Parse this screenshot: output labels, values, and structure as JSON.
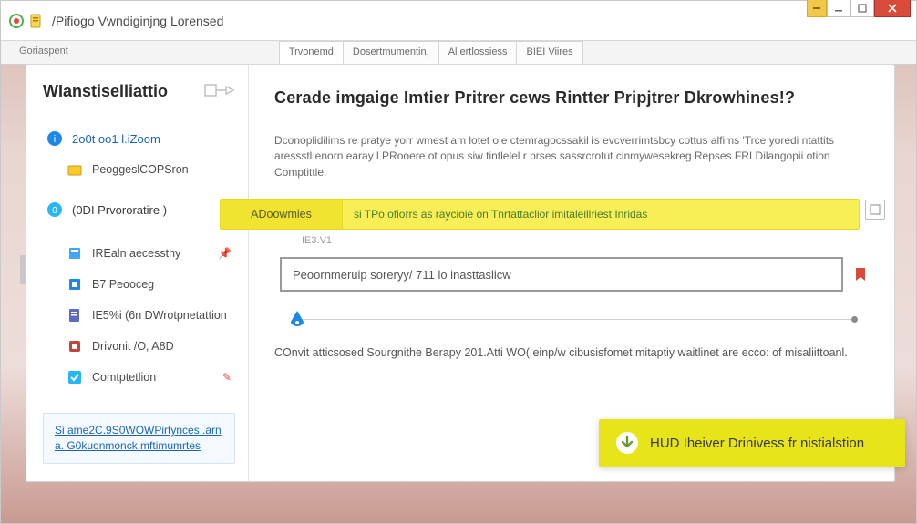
{
  "window": {
    "title": "/Pifiogo Vwndiginjng Lorensed"
  },
  "tabs": {
    "crumb": "Goriaspent",
    "items": [
      "Trvonemd",
      "Dosertmumentin,",
      "Al ertlossiess",
      "BIEI Viires"
    ]
  },
  "sidebar": {
    "heading": "WIanstiselliattio",
    "items": [
      {
        "label": "2o0t oo1 l.iZoom"
      },
      {
        "label": "PeoggeslCOPSron"
      },
      {
        "label": "(0DI Prvororatire )"
      },
      {
        "label": "IREaln aecessthy"
      },
      {
        "label": "B7 Peooceg"
      },
      {
        "label": "IE5%i (6n DWrotpnetattion"
      },
      {
        "label": "Drivonit /O, A8D"
      },
      {
        "label": "Comtptetlion"
      }
    ],
    "links": {
      "line1": "Si ame2C.9S0WOWPirtynces .arn",
      "line2": "a. G0kuonmonck.mftimumrtes"
    }
  },
  "main": {
    "heading": "Cerade imgaige Imtier Pritrer cews Rintter Pripjtrer Dkrowhines!?",
    "desc": "Dconoplidilims re pratye yorr wmest am lotet ole ctemragocssakil is evcverrimtsbcy cottus alfims 'Trce yoredi ntattits aressstl enorn earay l PRooere ot opus siw tintlelel r prses sassrcrotut cinmywesekreg Repses FRI Dilangopii otion Comptittle.",
    "hl_tag": "ADoowmies",
    "hl_note": "si TPo ofiorrs as raycioie on Tnrtattaclior imitaleillriest Inridas",
    "subnote": "IE3.V1",
    "search_value": "Peoornmeruip soreryy/ 711 lo inasttaslicw",
    "confirm": "COnvit atticsosed Sourgnithe Berapy 201.Atti WO( einp/w cibusisfomet mitaptiy waitlinet are ecco: of misaliittoanl.",
    "cta": "HUD Iheiver Drinivess fr nistialstion"
  }
}
